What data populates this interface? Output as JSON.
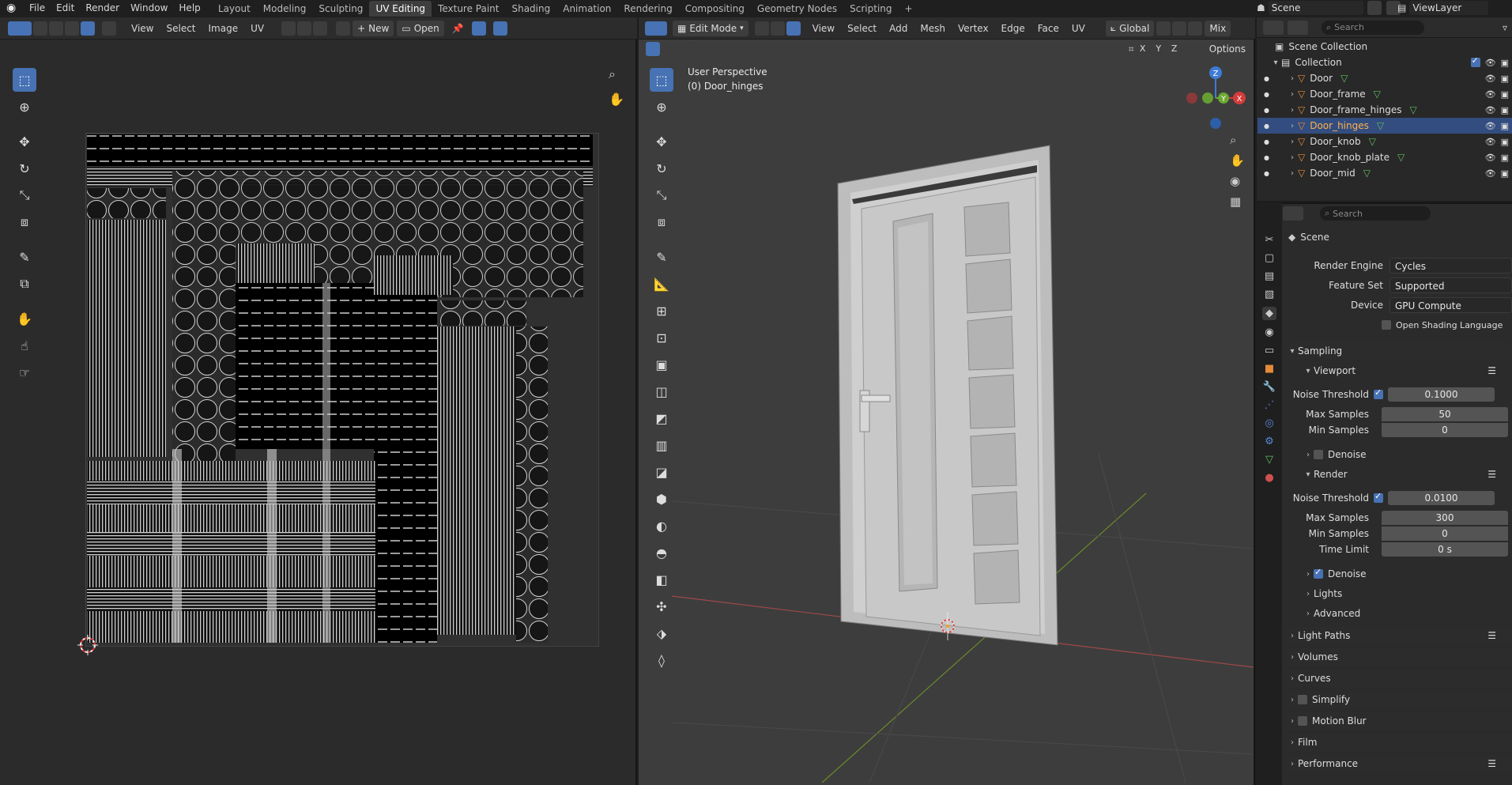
{
  "app": {
    "name": "Blender"
  },
  "menus": [
    "File",
    "Edit",
    "Render",
    "Window",
    "Help"
  ],
  "workspaces": [
    "Layout",
    "Modeling",
    "Sculpting",
    "UV Editing",
    "Texture Paint",
    "Shading",
    "Animation",
    "Rendering",
    "Compositing",
    "Geometry Nodes",
    "Scripting"
  ],
  "active_workspace_index": 3,
  "scene": {
    "label": "Scene",
    "view_layer": "ViewLayer"
  },
  "uv_editor": {
    "menus": [
      "View",
      "Select",
      "Image",
      "UV"
    ],
    "new_label": "New",
    "open_label": "Open"
  },
  "viewport": {
    "mode": "Edit Mode",
    "menus": [
      "View",
      "Select",
      "Add",
      "Mesh",
      "Vertex",
      "Edge",
      "Face",
      "UV"
    ],
    "orientation": "Global",
    "shading": "Mix",
    "options_label": "Options",
    "axes": [
      "X",
      "Y",
      "Z"
    ],
    "overlay_title": "User Perspective",
    "overlay_object": "(0) Door_hinges",
    "gizmo": {
      "z": "Z",
      "y": "Y",
      "x": "X"
    }
  },
  "outliner": {
    "search_placeholder": "Search",
    "root": "Scene Collection",
    "collection": "Collection",
    "objects": [
      "Door",
      "Door_frame",
      "Door_frame_hinges",
      "Door_hinges",
      "Door_knob",
      "Door_knob_plate",
      "Door_mid"
    ],
    "selected_index": 3
  },
  "properties": {
    "search_placeholder": "Search",
    "context": "Scene",
    "render_engine_label": "Render Engine",
    "render_engine": "Cycles",
    "feature_set_label": "Feature Set",
    "feature_set": "Supported",
    "device_label": "Device",
    "device": "GPU Compute",
    "osl_label": "Open Shading Language",
    "sampling_label": "Sampling",
    "viewport_label": "Viewport",
    "noise_threshold_label": "Noise Threshold",
    "vp_noise": "0.1000",
    "max_samples_label": "Max Samples",
    "vp_max": "50",
    "min_samples_label": "Min Samples",
    "vp_min": "0",
    "denoise_label": "Denoise",
    "render_label": "Render",
    "r_noise": "0.0100",
    "r_max": "300",
    "r_min": "0",
    "time_limit_label": "Time Limit",
    "r_time": "0 s",
    "lights_label": "Lights",
    "advanced_label": "Advanced",
    "sections": [
      "Light Paths",
      "Volumes",
      "Curves",
      "Simplify",
      "Motion Blur",
      "Film",
      "Performance"
    ]
  },
  "colors": {
    "accent": "#4772b3",
    "bg": "#1d1d1d",
    "header": "#2c2c2c",
    "viewport_bg": "#3d3d3d"
  }
}
